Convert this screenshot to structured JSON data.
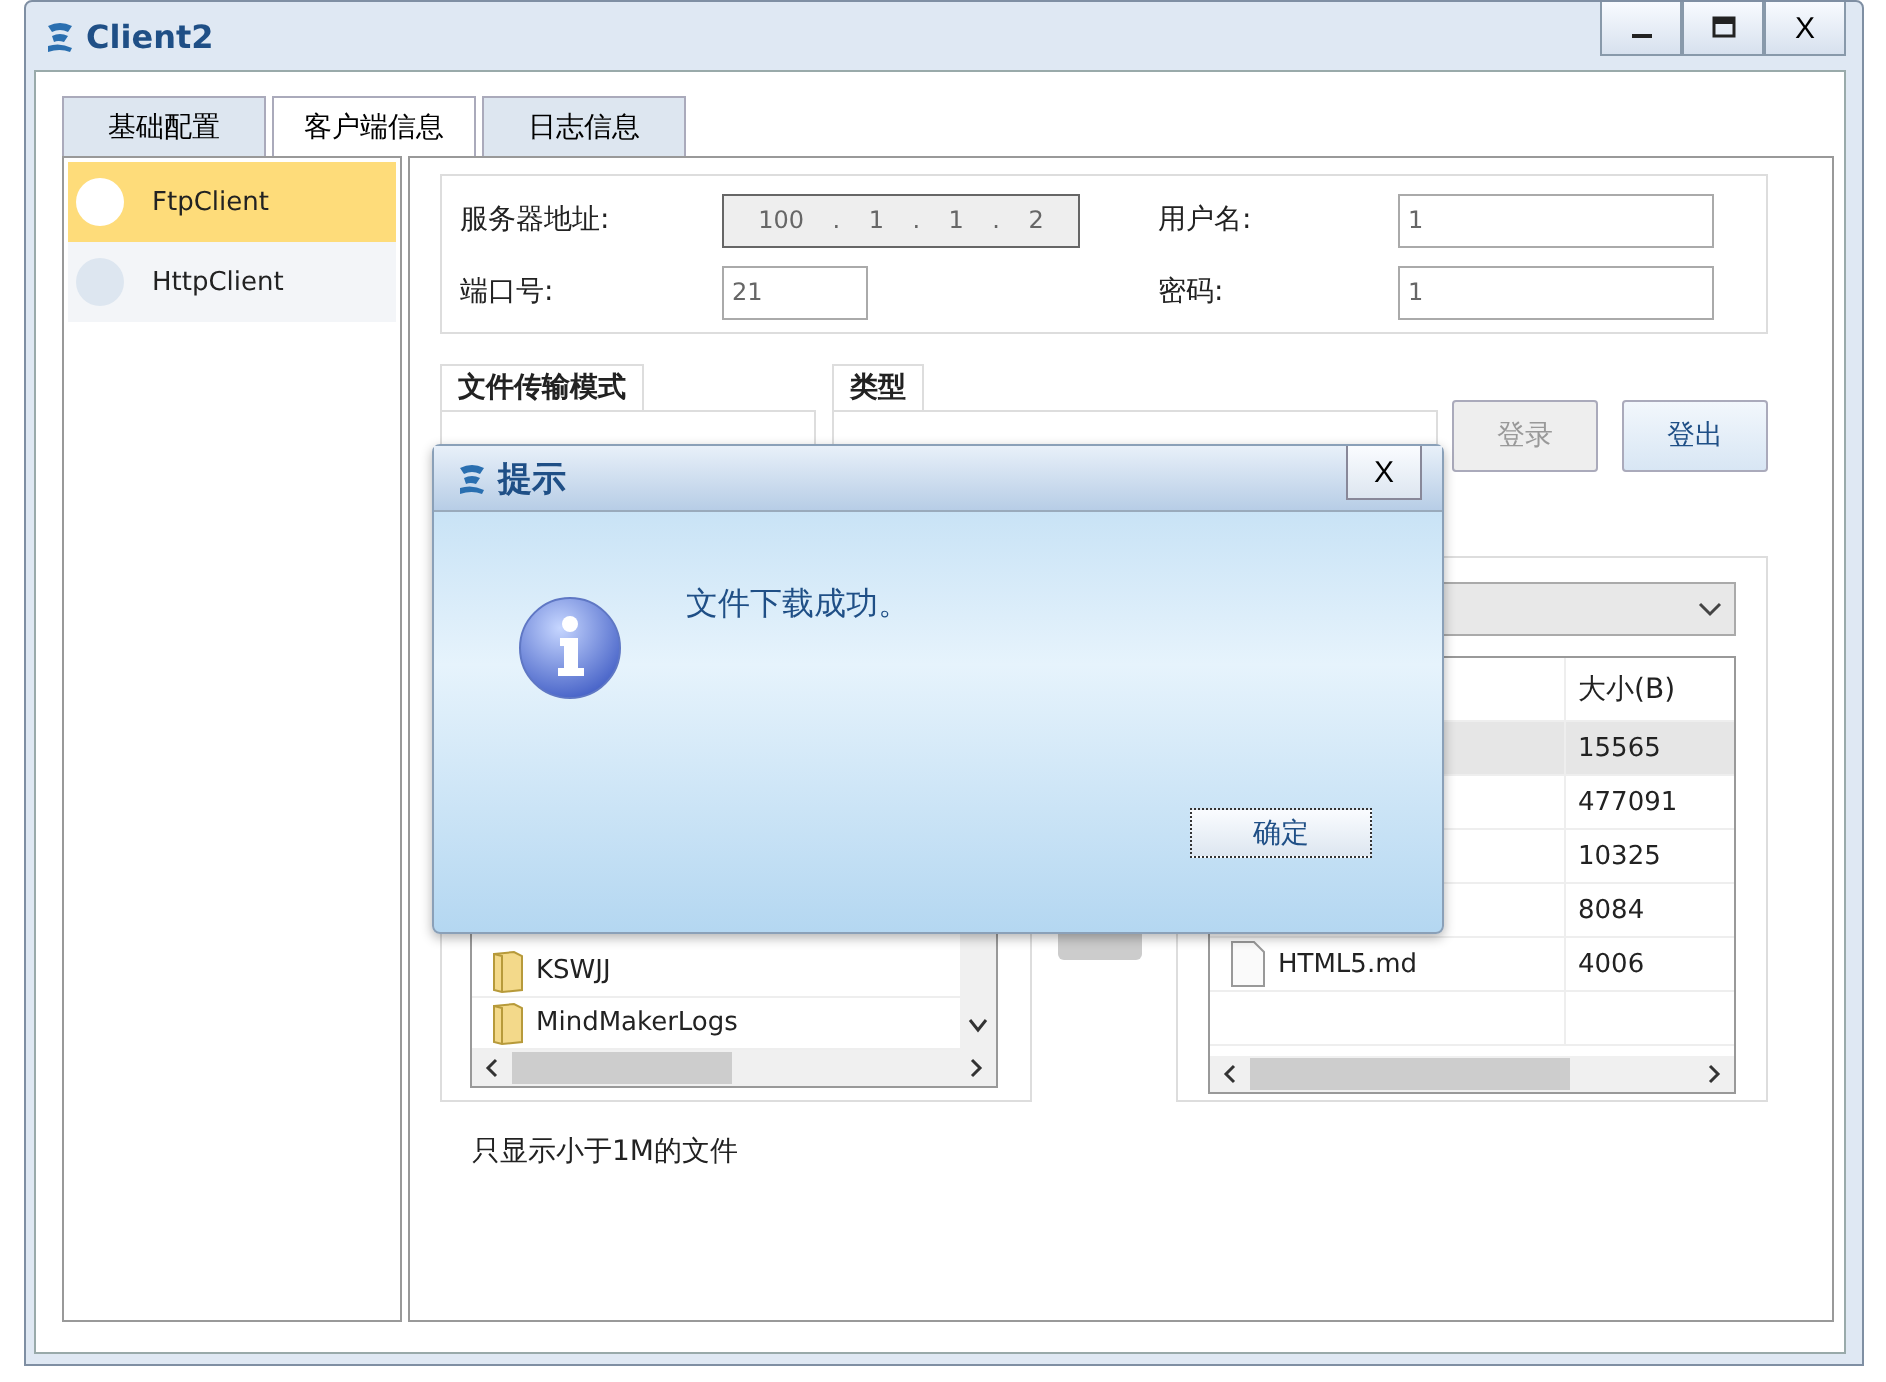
{
  "window": {
    "title": "Client2",
    "close": "X"
  },
  "tabs": [
    {
      "label": "基础配置",
      "selected": false
    },
    {
      "label": "客户端信息",
      "selected": true
    },
    {
      "label": "日志信息",
      "selected": false
    }
  ],
  "sidebar": {
    "items": [
      {
        "label": "FtpClient",
        "selected": true
      },
      {
        "label": "HttpClient",
        "selected": false
      }
    ]
  },
  "server": {
    "address_label": "服务器地址:",
    "address": [
      "100",
      ".",
      "1",
      ".",
      "1",
      ".",
      "2"
    ],
    "port_label": "端口号:",
    "port": "21",
    "user_label": "用户名:",
    "user": "1",
    "password_label": "密码:",
    "password": "1"
  },
  "groups": [
    {
      "title": "文件传输模式"
    },
    {
      "title": "类型"
    }
  ],
  "buttons": [
    {
      "label": "登录",
      "disabled": true
    },
    {
      "label": "登出",
      "disabled": false
    }
  ],
  "local_files": [
    {
      "name": "KSWJJ",
      "kind": "folder"
    },
    {
      "name": "MindMakerLogs",
      "kind": "folder"
    }
  ],
  "remote_files": {
    "column_2": "大小(B)",
    "rows": [
      {
        "size": "15565",
        "selected": true
      },
      {
        "size": "477091",
        "selected": false
      },
      {
        "size": "10325",
        "selected": false
      },
      {
        "size": "8084",
        "selected": false
      },
      {
        "name": "HTML5.md",
        "size": "4006",
        "selected": false
      }
    ]
  },
  "note": "只显示小于1M的文件",
  "dialog": {
    "title": "提示",
    "close": "X",
    "message": "文件下载成功。",
    "ok": "确定"
  }
}
